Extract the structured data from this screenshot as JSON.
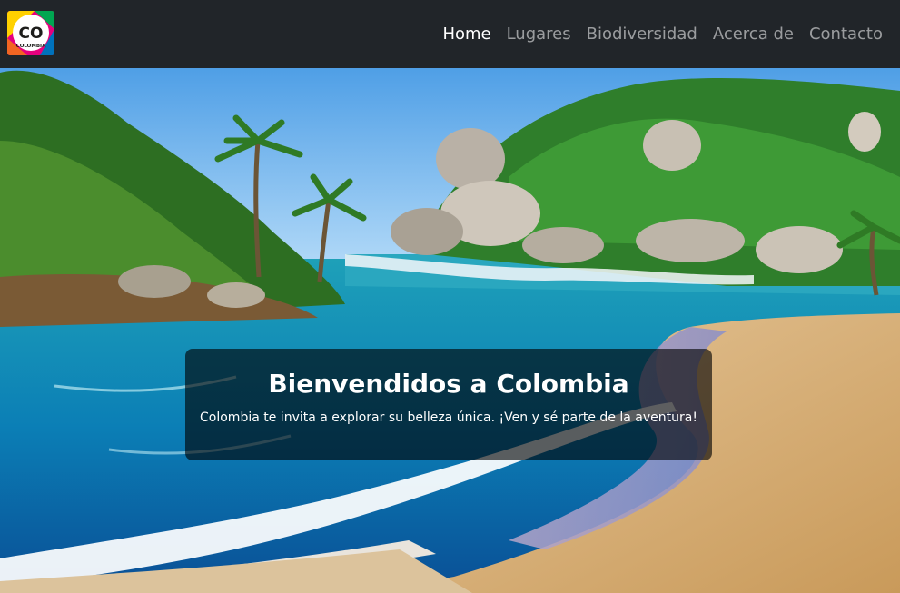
{
  "brand": {
    "logo_text": "CO",
    "logo_subtext": "COLOMBIA"
  },
  "nav": {
    "items": [
      {
        "label": "Home",
        "active": true
      },
      {
        "label": "Lugares"
      },
      {
        "label": "Biodiversidad"
      },
      {
        "label": "Acerca de"
      },
      {
        "label": "Contacto"
      }
    ]
  },
  "hero": {
    "image": "tropical-beach-photo",
    "title": "Bienvendidos a Colombia",
    "subtitle": "Colombia te invita a explorar su belleza única. ¡Ven y sé parte de la aventura!"
  },
  "colors": {
    "navbar": "#212529",
    "nav_active": "#ffffff",
    "nav_inactive": "rgba(255,255,255,0.55)"
  }
}
